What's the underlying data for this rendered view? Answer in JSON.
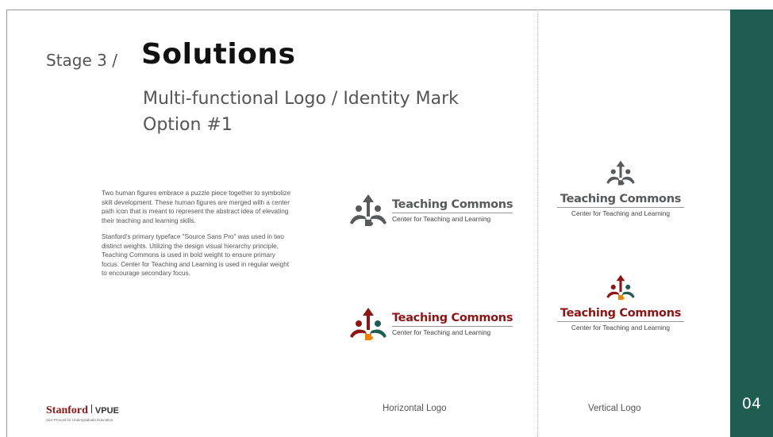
{
  "header": {
    "stage": "Stage 3  /",
    "title": "Solutions",
    "subtitle_line1": "Multi-functional Logo / Identity Mark",
    "subtitle_line2": "Option #1"
  },
  "description": {
    "paragraph1": "Two human figures embrace a puzzle piece together to symbolize skill development. These human figures are merged with a center path icon that is meant to represent the abstract idea of elevating their teaching and learning skills.",
    "paragraph2": "Stanford's primary typeface \"Source Sans Pro\" was used in two distinct weights. Utilizing the design visual hierarchy principle, Teaching Commons is used in bold weight to ensure primary focus. Center for Teaching and Learning is used in regular weight to encourage secondary focus."
  },
  "logos": {
    "name": "Teaching Commons",
    "tagline": "Center for Teaching and Learning"
  },
  "captions": {
    "horizontal": "Horizontal Logo",
    "vertical": "Vertical Logo"
  },
  "footer": {
    "stanford": "Stanford",
    "vpue": "VPUE",
    "vpue_tagline": "Vice Provost for Undergraduate Education",
    "page_number": "04"
  },
  "colors": {
    "accent_green": "#1f5c52",
    "cardinal_red": "#8c1515",
    "logo_gray": "#58595b"
  }
}
